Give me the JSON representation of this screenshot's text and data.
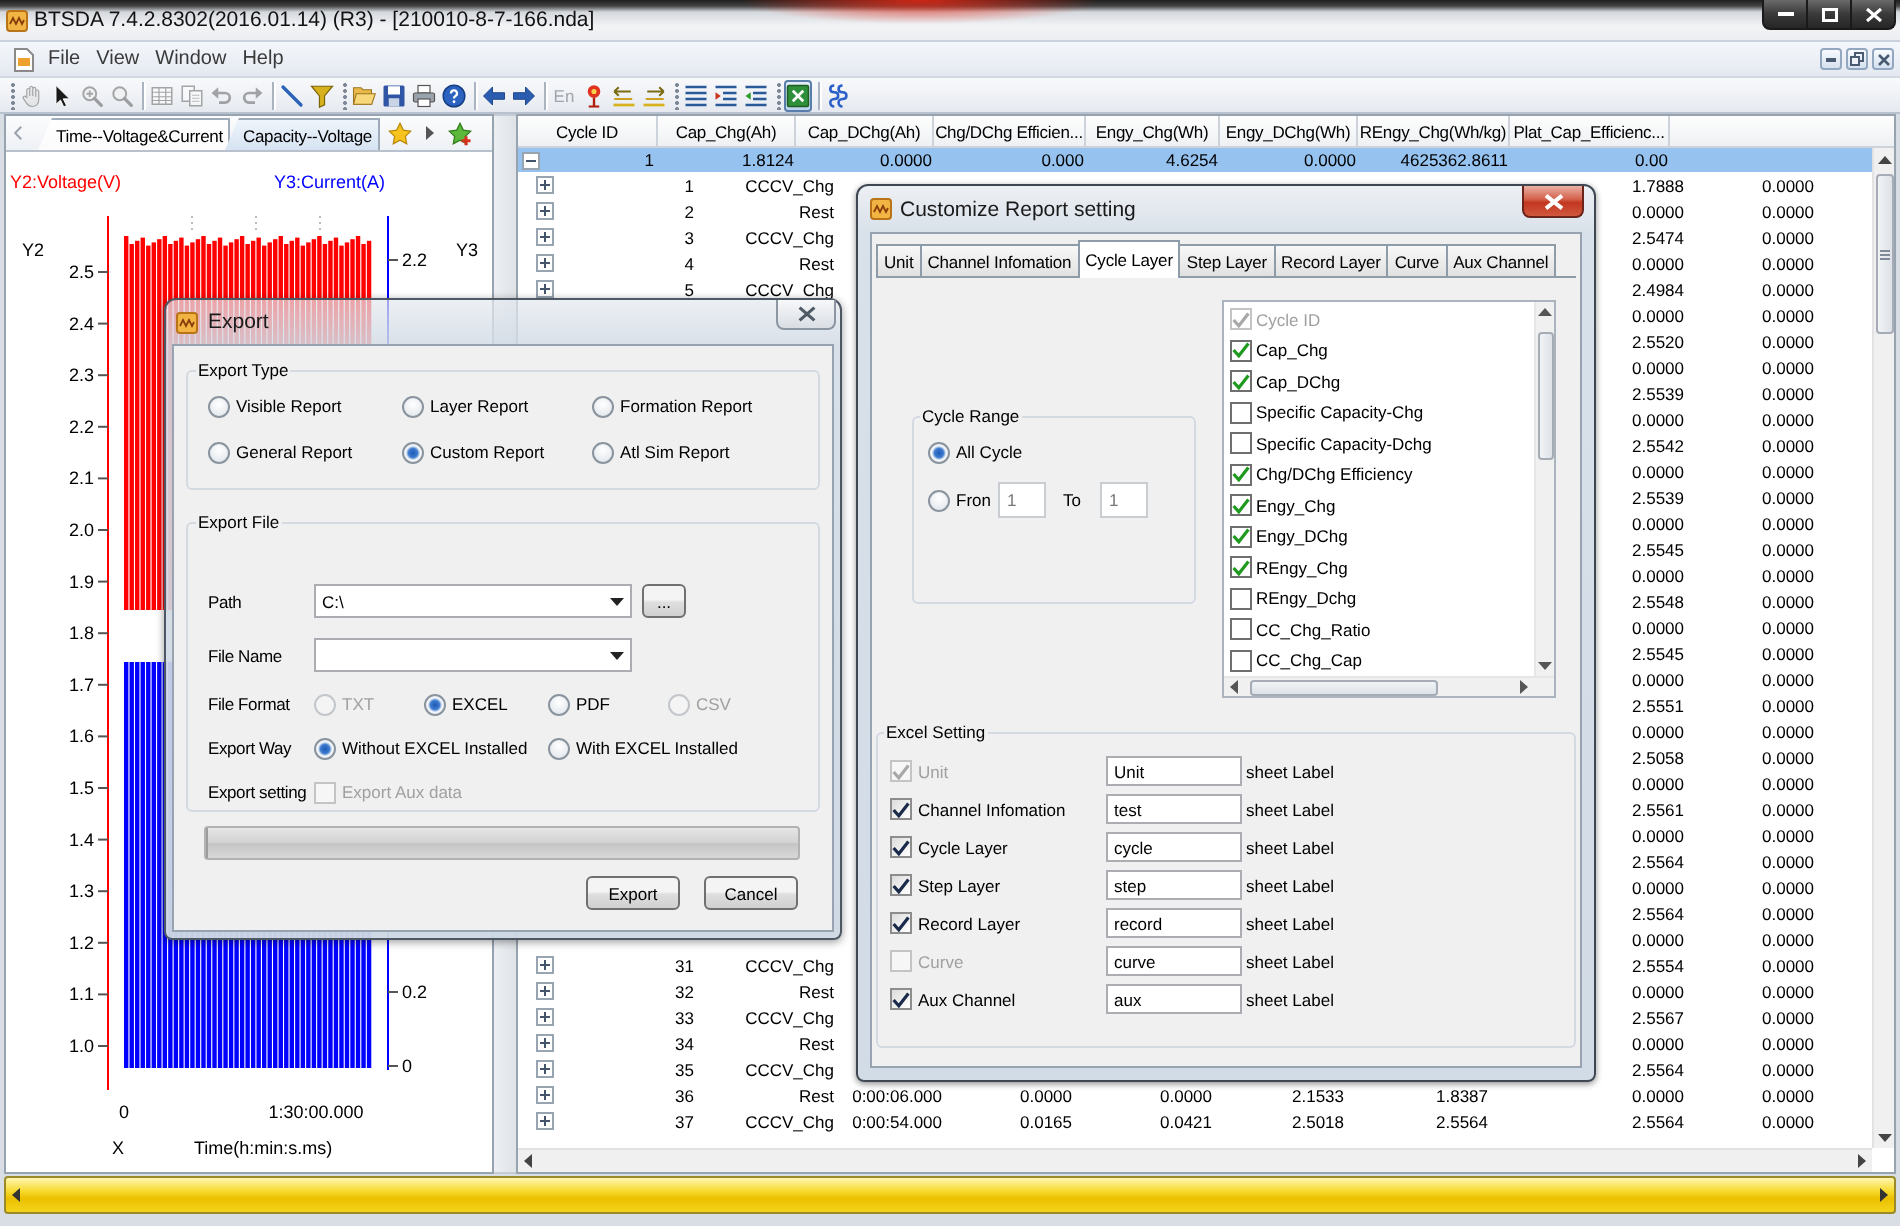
{
  "window": {
    "title": "BTSDA 7.4.2.8302(2016.01.14) (R3) - [210010-8-7-166.nda]"
  },
  "menu": [
    "File",
    "View",
    "Window",
    "Help"
  ],
  "toolbar": [
    {
      "kind": "grip"
    },
    {
      "kind": "hand",
      "disabled": true,
      "pressed": false
    },
    {
      "kind": "pointer",
      "disabled": false,
      "pressed": false
    },
    {
      "kind": "zoom-area",
      "disabled": true,
      "pressed": false
    },
    {
      "kind": "zoom",
      "disabled": true,
      "pressed": false
    },
    {
      "kind": "separator"
    },
    {
      "kind": "table",
      "disabled": true,
      "pressed": false
    },
    {
      "kind": "copy",
      "disabled": true,
      "pressed": false
    },
    {
      "kind": "undo",
      "disabled": true,
      "pressed": false
    },
    {
      "kind": "redo",
      "disabled": true,
      "pressed": false
    },
    {
      "kind": "separator"
    },
    {
      "kind": "line",
      "disabled": false,
      "pressed": false
    },
    {
      "kind": "filter",
      "disabled": false,
      "pressed": false
    },
    {
      "kind": "grip"
    },
    {
      "kind": "open",
      "disabled": false,
      "pressed": false
    },
    {
      "kind": "save",
      "disabled": false,
      "pressed": false
    },
    {
      "kind": "print",
      "disabled": false,
      "pressed": false
    },
    {
      "kind": "help",
      "disabled": false,
      "pressed": false
    },
    {
      "kind": "separator"
    },
    {
      "kind": "back",
      "disabled": false,
      "pressed": false
    },
    {
      "kind": "forward",
      "disabled": false,
      "pressed": false
    },
    {
      "kind": "separator"
    },
    {
      "kind": "text",
      "label": "En",
      "disabled": true,
      "pressed": false
    },
    {
      "kind": "marker",
      "disabled": false,
      "pressed": false
    },
    {
      "kind": "swap-left",
      "disabled": false,
      "pressed": false
    },
    {
      "kind": "swap-right",
      "disabled": false,
      "pressed": false
    },
    {
      "kind": "grip"
    },
    {
      "kind": "list",
      "disabled": false,
      "pressed": false
    },
    {
      "kind": "list-expand",
      "disabled": false,
      "pressed": false
    },
    {
      "kind": "list-collapse",
      "disabled": false,
      "pressed": false
    },
    {
      "kind": "grip"
    },
    {
      "kind": "excel",
      "disabled": false,
      "pressed": true
    },
    {
      "kind": "separator"
    },
    {
      "kind": "channels",
      "disabled": false,
      "pressed": false
    }
  ],
  "chart_tabs": [
    {
      "label": "Time--Voltage&Current",
      "selected": true
    },
    {
      "label": "Capacity--Voltage",
      "selected": false
    }
  ],
  "chart": {
    "series": [
      {
        "label": "Y2:Voltage(V)",
        "axis": "Y2",
        "color": "#ff0000",
        "ticks": [
          "2.5",
          "2.4",
          "2.3",
          "2.2",
          "2.1",
          "2.0",
          "1.9",
          "1.8",
          "1.7",
          "1.6",
          "1.5",
          "1.4",
          "1.3",
          "1.2",
          "1.1",
          "1.0"
        ]
      },
      {
        "label": "Y3:Current(A)",
        "axis": "Y3",
        "color": "#0000ff",
        "ticks": [
          "2.2",
          "0.2",
          "0"
        ]
      }
    ],
    "x_axis": {
      "name": "X",
      "label": "Time(h:min:s.ms)",
      "ticks": [
        "0",
        "1:30:00.000"
      ]
    }
  },
  "table": {
    "columns": [
      "Cycle ID",
      "Cap_Chg(Ah)",
      "Cap_DChg(Ah)",
      "Chg/DChg Efficien...",
      "Engy_Chg(Wh)",
      "Engy_DChg(Wh)",
      "REngy_Chg(Wh/kg)",
      "Plat_Cap_Efficienc..."
    ],
    "rows": [
      {
        "expanded": true,
        "selected": true,
        "cells": [
          "1",
          "1.8124",
          "0.0000",
          "0.000",
          "4.6254",
          "0.0000",
          "4625362.8611",
          "0.00"
        ],
        "children": [
          {
            "selected": false,
            "expanded": false,
            "column_1": "1",
            "column_2": "CCCV_Chg",
            "column_8": "1.7888",
            "column_9": "0.0000"
          },
          {
            "selected": false,
            "expanded": false,
            "column_1": "2",
            "column_2": "Rest",
            "column_8": "0.0000",
            "column_9": "0.0000"
          },
          {
            "selected": false,
            "expanded": false,
            "column_1": "3",
            "column_2": "CCCV_Chg",
            "column_8": "2.5474",
            "column_9": "0.0000"
          },
          {
            "selected": false,
            "expanded": false,
            "column_1": "4",
            "column_2": "Rest",
            "column_8": "0.0000",
            "column_9": "0.0000"
          },
          {
            "selected": false,
            "expanded": false,
            "column_1": "5",
            "column_2": "CCCV_Chg",
            "column_8": "2.4984",
            "column_9": "0.0000"
          },
          {
            "selected": false,
            "column_8": "0.0000",
            "column_9": "0.0000"
          },
          {
            "selected": false,
            "column_8": "2.5520",
            "column_9": "0.0000"
          },
          {
            "selected": false,
            "column_8": "0.0000",
            "column_9": "0.0000"
          },
          {
            "selected": false,
            "column_8": "2.5539",
            "column_9": "0.0000"
          },
          {
            "selected": false,
            "column_8": "0.0000",
            "column_9": "0.0000"
          },
          {
            "selected": false,
            "column_8": "2.5542",
            "column_9": "0.0000"
          },
          {
            "selected": false,
            "column_8": "0.0000",
            "column_9": "0.0000"
          },
          {
            "selected": false,
            "column_8": "2.5539",
            "column_9": "0.0000"
          },
          {
            "selected": false,
            "column_8": "0.0000",
            "column_9": "0.0000"
          },
          {
            "selected": false,
            "column_8": "2.5545",
            "column_9": "0.0000"
          },
          {
            "selected": false,
            "column_8": "0.0000",
            "column_9": "0.0000"
          },
          {
            "selected": false,
            "column_8": "2.5548",
            "column_9": "0.0000"
          },
          {
            "selected": false,
            "column_8": "0.0000",
            "column_9": "0.0000"
          },
          {
            "selected": false,
            "column_8": "2.5545",
            "column_9": "0.0000"
          },
          {
            "selected": false,
            "column_8": "0.0000",
            "column_9": "0.0000"
          },
          {
            "selected": false,
            "column_8": "2.5551",
            "column_9": "0.0000"
          },
          {
            "selected": false,
            "column_8": "0.0000",
            "column_9": "0.0000"
          },
          {
            "selected": false,
            "column_8": "2.5058",
            "column_9": "0.0000"
          },
          {
            "selected": false,
            "column_8": "0.0000",
            "column_9": "0.0000"
          },
          {
            "selected": false,
            "column_8": "2.5561",
            "column_9": "0.0000"
          },
          {
            "selected": false,
            "column_8": "0.0000",
            "column_9": "0.0000"
          },
          {
            "selected": false,
            "column_8": "2.5564",
            "column_9": "0.0000"
          },
          {
            "selected": false,
            "column_8": "0.0000",
            "column_9": "0.0000"
          },
          {
            "selected": false,
            "column_8": "2.5564",
            "column_9": "0.0000"
          },
          {
            "selected": false,
            "column_8": "0.0000",
            "column_9": "0.0000"
          },
          {
            "selected": false,
            "expanded": false,
            "column_1": "31",
            "column_2": "CCCV_Chg",
            "column_8": "2.5554",
            "column_9": "0.0000"
          },
          {
            "selected": false,
            "expanded": false,
            "column_1": "32",
            "column_2": "Rest",
            "column_8": "0.0000",
            "column_9": "0.0000"
          },
          {
            "selected": false,
            "expanded": false,
            "column_1": "33",
            "column_2": "CCCV_Chg",
            "column_8": "2.5567",
            "column_9": "0.0000"
          },
          {
            "selected": false,
            "expanded": false,
            "column_1": "34",
            "column_2": "Rest",
            "column_8": "0.0000",
            "column_9": "0.0000"
          },
          {
            "selected": false,
            "expanded": false,
            "column_1": "35",
            "column_2": "CCCV_Chg",
            "column_8": "2.5564",
            "column_9": "0.0000"
          },
          {
            "selected": false,
            "expanded": false,
            "column_1": "36",
            "column_2": "Rest",
            "column_3": "0:00:06.000",
            "column_4": "0.0000",
            "column_5": "0.0000",
            "column_6": "2.1533",
            "column_7": "1.8387",
            "column_8": "0.0000",
            "column_9": "0.0000"
          },
          {
            "selected": false,
            "expanded": false,
            "column_1": "37",
            "column_2": "CCCV_Chg",
            "column_3": "0:00:54.000",
            "column_4": "0.0165",
            "column_5": "0.0421",
            "column_6": "2.5018",
            "column_7": "2.5564",
            "column_8": "2.5564",
            "column_9": "0.0000"
          }
        ]
      }
    ]
  },
  "export_dialog": {
    "title": "Export",
    "export_type": {
      "label": "Export Type",
      "options": [
        {
          "label": "Visible Report",
          "selected": false
        },
        {
          "label": "Layer Report",
          "selected": false
        },
        {
          "label": "Formation Report",
          "selected": false
        },
        {
          "label": "General Report",
          "selected": false
        },
        {
          "label": "Custom Report",
          "selected": true
        },
        {
          "label": "Atl Sim Report",
          "selected": false
        }
      ]
    },
    "export_file": {
      "label": "Export File",
      "path": {
        "label": "Path",
        "value": "C:\\"
      },
      "browse_button": "...",
      "file_name": {
        "label": "File Name"
      },
      "file_format": {
        "label": "File Format",
        "options": [
          {
            "label": "TXT",
            "selected": false,
            "disabled": true
          },
          {
            "label": "EXCEL",
            "selected": true,
            "disabled": false
          },
          {
            "label": "PDF",
            "selected": false,
            "disabled": false
          },
          {
            "label": "CSV",
            "selected": false,
            "disabled": true
          }
        ]
      },
      "export_way": {
        "label": "Export Way",
        "options": [
          {
            "label": "Without EXCEL Installed",
            "selected": true
          },
          {
            "label": "With EXCEL Installed",
            "selected": false
          }
        ]
      },
      "export_setting": {
        "label": "Export setting",
        "option": {
          "label": "Export Aux data",
          "checked": false,
          "disabled": true
        }
      }
    },
    "progress": {
      "level": 0
    },
    "buttons": [
      "Export",
      "Cancel"
    ]
  },
  "report_dialog": {
    "title": "Customize Report setting",
    "tabs": [
      {
        "label": "Unit",
        "selected": false
      },
      {
        "label": "Channel Infomation",
        "selected": false
      },
      {
        "label": "Cycle Layer",
        "selected": true
      },
      {
        "label": "Step Layer",
        "selected": false
      },
      {
        "label": "Record Layer",
        "selected": false
      },
      {
        "label": "Curve",
        "selected": false
      },
      {
        "label": "Aux Channel",
        "selected": false
      }
    ],
    "cycle_range": {
      "label": "Cycle Range",
      "options": [
        {
          "label": "All Cycle",
          "selected": true
        },
        {
          "label": "Fron",
          "selected": false
        }
      ],
      "from": {
        "value": "1",
        "disabled": true
      },
      "to_label": "To",
      "to": {
        "value": "1",
        "disabled": true
      }
    },
    "fields": [
      {
        "label": "Cycle ID",
        "checked": true,
        "disabled": true
      },
      {
        "label": "Cap_Chg",
        "checked": true,
        "disabled": false
      },
      {
        "label": "Cap_DChg",
        "checked": true,
        "disabled": false
      },
      {
        "label": "Specific Capacity-Chg",
        "checked": false,
        "disabled": false
      },
      {
        "label": "Specific Capacity-Dchg",
        "checked": false,
        "disabled": false
      },
      {
        "label": "Chg/DChg Efficiency",
        "checked": true,
        "disabled": false
      },
      {
        "label": "Engy_Chg",
        "checked": true,
        "disabled": false
      },
      {
        "label": "Engy_DChg",
        "checked": true,
        "disabled": false
      },
      {
        "label": "REngy_Chg",
        "checked": true,
        "disabled": false
      },
      {
        "label": "REngy_Dchg",
        "checked": false,
        "disabled": false
      },
      {
        "label": "CC_Chg_Ratio",
        "checked": false,
        "disabled": false
      },
      {
        "label": "CC_Chg_Cap",
        "checked": false,
        "disabled": false
      }
    ],
    "excel_setting": {
      "label": "Excel Setting",
      "rows": [
        {
          "label": "Unit",
          "checked": true,
          "disabled": true,
          "value": "Unit",
          "suffix": "sheet Label"
        },
        {
          "label": "Channel Infomation",
          "checked": true,
          "disabled": false,
          "value": "test",
          "suffix": "sheet Label"
        },
        {
          "label": "Cycle Layer",
          "checked": true,
          "disabled": false,
          "value": "cycle",
          "suffix": "sheet Label"
        },
        {
          "label": "Step Layer",
          "checked": true,
          "disabled": false,
          "value": "step",
          "suffix": "sheet Label"
        },
        {
          "label": "Record Layer",
          "checked": true,
          "disabled": false,
          "value": "record",
          "suffix": "sheet Label"
        },
        {
          "label": "Curve",
          "checked": false,
          "disabled": true,
          "value": "curve",
          "suffix": "sheet Label"
        },
        {
          "label": "Aux Channel",
          "checked": true,
          "disabled": false,
          "value": "aux",
          "suffix": "sheet Label"
        }
      ]
    }
  }
}
